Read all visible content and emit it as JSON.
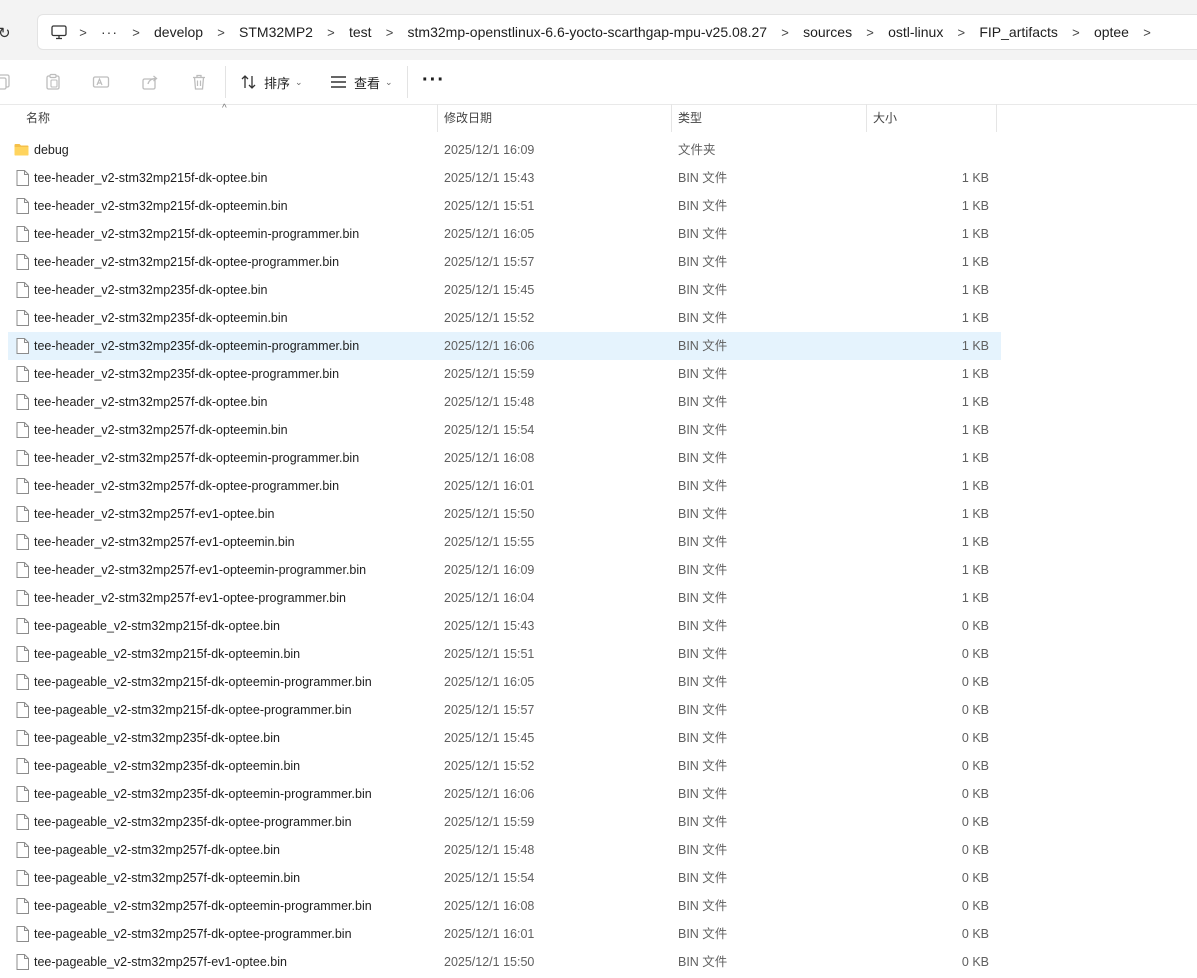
{
  "breadcrumb": {
    "ellipsis": "···",
    "items": [
      "develop",
      "STM32MP2",
      "test",
      "stm32mp-openstlinux-6.6-yocto-scarthgap-mpu-v25.08.27",
      "sources",
      "ostl-linux",
      "FIP_artifacts",
      "optee"
    ]
  },
  "toolbar": {
    "sort_label": "排序",
    "view_label": "查看",
    "more_label": "···"
  },
  "columns": {
    "name": "名称",
    "modified": "修改日期",
    "type": "类型",
    "size": "大小"
  },
  "selected_row_index": 7,
  "files": [
    {
      "name": "debug",
      "modified": "2025/12/1 16:09",
      "type": "文件夹",
      "size": "",
      "kind": "folder"
    },
    {
      "name": "tee-header_v2-stm32mp215f-dk-optee.bin",
      "modified": "2025/12/1 15:43",
      "type": "BIN 文件",
      "size": "1 KB",
      "kind": "file"
    },
    {
      "name": "tee-header_v2-stm32mp215f-dk-opteemin.bin",
      "modified": "2025/12/1 15:51",
      "type": "BIN 文件",
      "size": "1 KB",
      "kind": "file"
    },
    {
      "name": "tee-header_v2-stm32mp215f-dk-opteemin-programmer.bin",
      "modified": "2025/12/1 16:05",
      "type": "BIN 文件",
      "size": "1 KB",
      "kind": "file"
    },
    {
      "name": "tee-header_v2-stm32mp215f-dk-optee-programmer.bin",
      "modified": "2025/12/1 15:57",
      "type": "BIN 文件",
      "size": "1 KB",
      "kind": "file"
    },
    {
      "name": "tee-header_v2-stm32mp235f-dk-optee.bin",
      "modified": "2025/12/1 15:45",
      "type": "BIN 文件",
      "size": "1 KB",
      "kind": "file"
    },
    {
      "name": "tee-header_v2-stm32mp235f-dk-opteemin.bin",
      "modified": "2025/12/1 15:52",
      "type": "BIN 文件",
      "size": "1 KB",
      "kind": "file"
    },
    {
      "name": "tee-header_v2-stm32mp235f-dk-opteemin-programmer.bin",
      "modified": "2025/12/1 16:06",
      "type": "BIN 文件",
      "size": "1 KB",
      "kind": "file"
    },
    {
      "name": "tee-header_v2-stm32mp235f-dk-optee-programmer.bin",
      "modified": "2025/12/1 15:59",
      "type": "BIN 文件",
      "size": "1 KB",
      "kind": "file"
    },
    {
      "name": "tee-header_v2-stm32mp257f-dk-optee.bin",
      "modified": "2025/12/1 15:48",
      "type": "BIN 文件",
      "size": "1 KB",
      "kind": "file"
    },
    {
      "name": "tee-header_v2-stm32mp257f-dk-opteemin.bin",
      "modified": "2025/12/1 15:54",
      "type": "BIN 文件",
      "size": "1 KB",
      "kind": "file"
    },
    {
      "name": "tee-header_v2-stm32mp257f-dk-opteemin-programmer.bin",
      "modified": "2025/12/1 16:08",
      "type": "BIN 文件",
      "size": "1 KB",
      "kind": "file"
    },
    {
      "name": "tee-header_v2-stm32mp257f-dk-optee-programmer.bin",
      "modified": "2025/12/1 16:01",
      "type": "BIN 文件",
      "size": "1 KB",
      "kind": "file"
    },
    {
      "name": "tee-header_v2-stm32mp257f-ev1-optee.bin",
      "modified": "2025/12/1 15:50",
      "type": "BIN 文件",
      "size": "1 KB",
      "kind": "file"
    },
    {
      "name": "tee-header_v2-stm32mp257f-ev1-opteemin.bin",
      "modified": "2025/12/1 15:55",
      "type": "BIN 文件",
      "size": "1 KB",
      "kind": "file"
    },
    {
      "name": "tee-header_v2-stm32mp257f-ev1-opteemin-programmer.bin",
      "modified": "2025/12/1 16:09",
      "type": "BIN 文件",
      "size": "1 KB",
      "kind": "file"
    },
    {
      "name": "tee-header_v2-stm32mp257f-ev1-optee-programmer.bin",
      "modified": "2025/12/1 16:04",
      "type": "BIN 文件",
      "size": "1 KB",
      "kind": "file"
    },
    {
      "name": "tee-pageable_v2-stm32mp215f-dk-optee.bin",
      "modified": "2025/12/1 15:43",
      "type": "BIN 文件",
      "size": "0 KB",
      "kind": "file"
    },
    {
      "name": "tee-pageable_v2-stm32mp215f-dk-opteemin.bin",
      "modified": "2025/12/1 15:51",
      "type": "BIN 文件",
      "size": "0 KB",
      "kind": "file"
    },
    {
      "name": "tee-pageable_v2-stm32mp215f-dk-opteemin-programmer.bin",
      "modified": "2025/12/1 16:05",
      "type": "BIN 文件",
      "size": "0 KB",
      "kind": "file"
    },
    {
      "name": "tee-pageable_v2-stm32mp215f-dk-optee-programmer.bin",
      "modified": "2025/12/1 15:57",
      "type": "BIN 文件",
      "size": "0 KB",
      "kind": "file"
    },
    {
      "name": "tee-pageable_v2-stm32mp235f-dk-optee.bin",
      "modified": "2025/12/1 15:45",
      "type": "BIN 文件",
      "size": "0 KB",
      "kind": "file"
    },
    {
      "name": "tee-pageable_v2-stm32mp235f-dk-opteemin.bin",
      "modified": "2025/12/1 15:52",
      "type": "BIN 文件",
      "size": "0 KB",
      "kind": "file"
    },
    {
      "name": "tee-pageable_v2-stm32mp235f-dk-opteemin-programmer.bin",
      "modified": "2025/12/1 16:06",
      "type": "BIN 文件",
      "size": "0 KB",
      "kind": "file"
    },
    {
      "name": "tee-pageable_v2-stm32mp235f-dk-optee-programmer.bin",
      "modified": "2025/12/1 15:59",
      "type": "BIN 文件",
      "size": "0 KB",
      "kind": "file"
    },
    {
      "name": "tee-pageable_v2-stm32mp257f-dk-optee.bin",
      "modified": "2025/12/1 15:48",
      "type": "BIN 文件",
      "size": "0 KB",
      "kind": "file"
    },
    {
      "name": "tee-pageable_v2-stm32mp257f-dk-opteemin.bin",
      "modified": "2025/12/1 15:54",
      "type": "BIN 文件",
      "size": "0 KB",
      "kind": "file"
    },
    {
      "name": "tee-pageable_v2-stm32mp257f-dk-opteemin-programmer.bin",
      "modified": "2025/12/1 16:08",
      "type": "BIN 文件",
      "size": "0 KB",
      "kind": "file"
    },
    {
      "name": "tee-pageable_v2-stm32mp257f-dk-optee-programmer.bin",
      "modified": "2025/12/1 16:01",
      "type": "BIN 文件",
      "size": "0 KB",
      "kind": "file"
    },
    {
      "name": "tee-pageable_v2-stm32mp257f-ev1-optee.bin",
      "modified": "2025/12/1 15:50",
      "type": "BIN 文件",
      "size": "0 KB",
      "kind": "file"
    }
  ]
}
